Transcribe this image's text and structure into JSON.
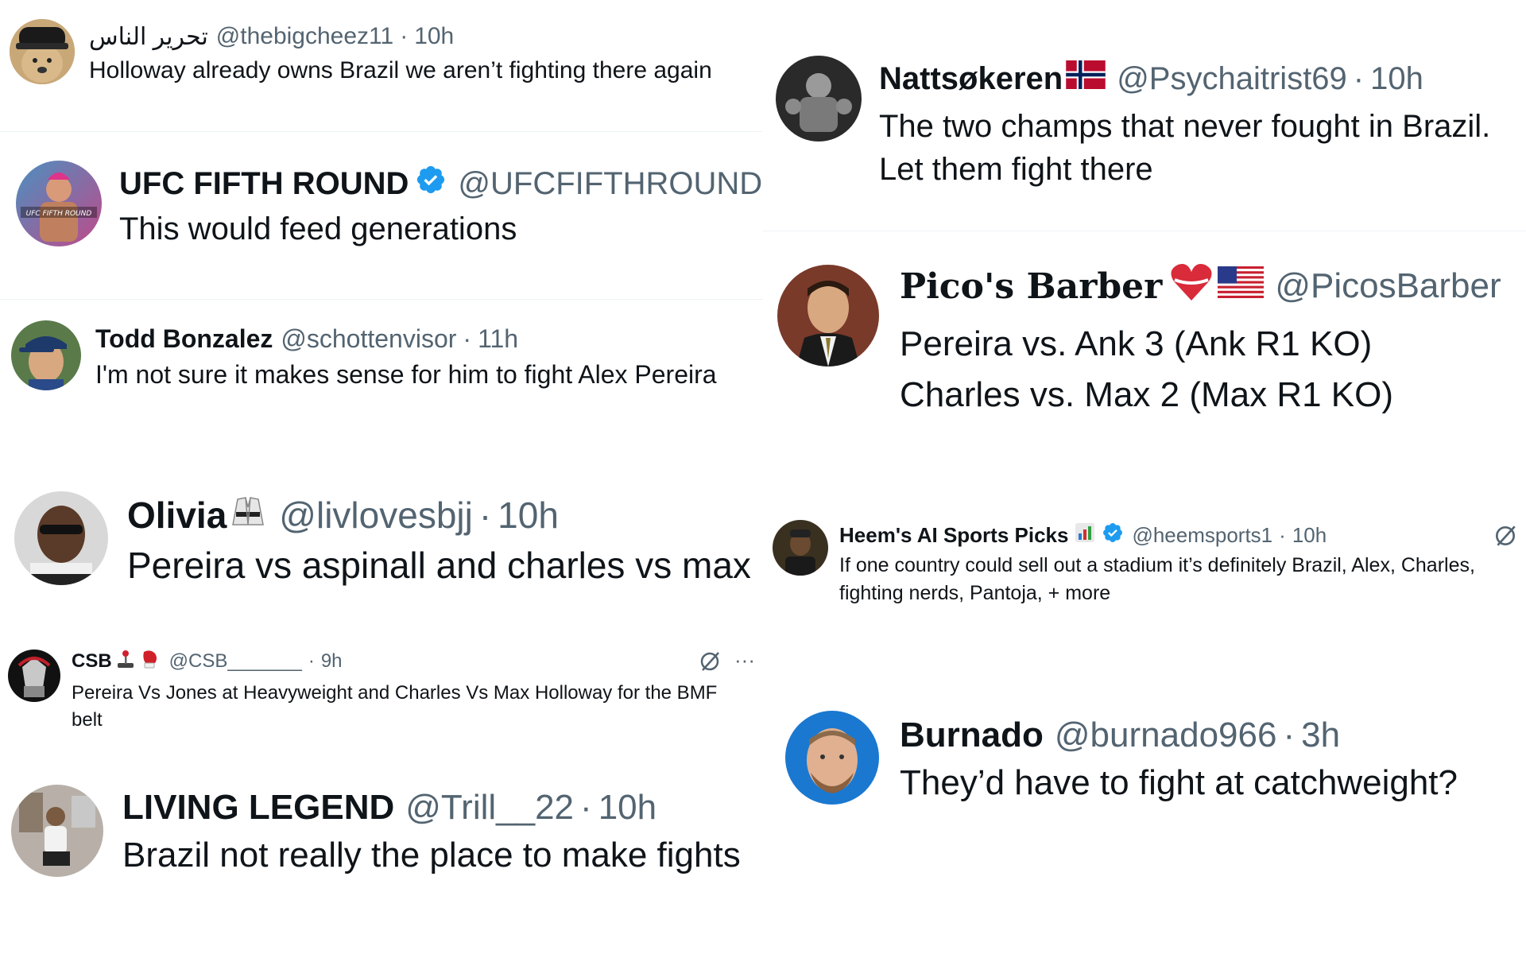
{
  "tweets": {
    "t1": {
      "name": "تحرير الناس",
      "handle": "@thebigcheez11",
      "time": "10h",
      "text": "Holloway already owns Brazil we aren’t fighting there again"
    },
    "t2": {
      "name": "UFC FIFTH ROUND",
      "handle": "@UFCFIFTHROUND",
      "text": "This would feed generations",
      "avatar_text": "UFC FIFTH ROUND"
    },
    "t3": {
      "name": "Todd Bonzalez",
      "handle": "@schottenvisor",
      "time": "11h",
      "text": "I'm not sure it makes sense for him to fight Alex Pereira"
    },
    "t4": {
      "name": "Olivia",
      "handle": "@livlovesbjj",
      "time": "10h",
      "text": "Pereira vs aspinall and charles vs max"
    },
    "t5": {
      "name": "CSB",
      "handle": "@CSB_______",
      "time": "9h",
      "text": "Pereira Vs Jones at Heavyweight and Charles Vs Max Holloway for the BMF belt"
    },
    "t6": {
      "name": "LIVING LEGEND",
      "handle": "@Trill__22",
      "time": "10h",
      "text": "Brazil not really the place to make fights"
    },
    "t7": {
      "name": "Nattsøkeren",
      "handle": "@Psychaitrist69",
      "time": "10h",
      "text_line1": "The two champs that never fought in Brazil.",
      "text_line2": "Let them fight there"
    },
    "t8": {
      "name": "Pico's Barber",
      "handle": "@PicosBarber",
      "text_line1": "Pereira vs. Ank 3 (Ank R1 KO)",
      "text_line2": "Charles vs. Max 2 (Max R1 KO)"
    },
    "t9": {
      "name": "Heem's AI Sports Picks",
      "handle": "@heemsports1",
      "time": "10h",
      "text_line1": "If one country could sell out a stadium it’s definitely Brazil, Alex, Charles,",
      "text_line2": "fighting nerds, Pantoja, + more"
    },
    "t10": {
      "name": "Burnado",
      "handle": "@burnado966",
      "time": "3h",
      "text": "They’d have to fight at catchweight?"
    }
  },
  "colors": {
    "text": "#0f1419",
    "muted": "#536471",
    "verified": "#1d9bf0",
    "divider": "#eff3f4"
  },
  "icons": [
    "verified-badge-icon",
    "grok-icon",
    "more-icon",
    "norway-flag-icon",
    "us-flag-icon",
    "heart-icon",
    "gi-emoji-icon",
    "joystick-emoji-icon",
    "boxing-glove-icon",
    "bar-chart-emoji-icon"
  ]
}
